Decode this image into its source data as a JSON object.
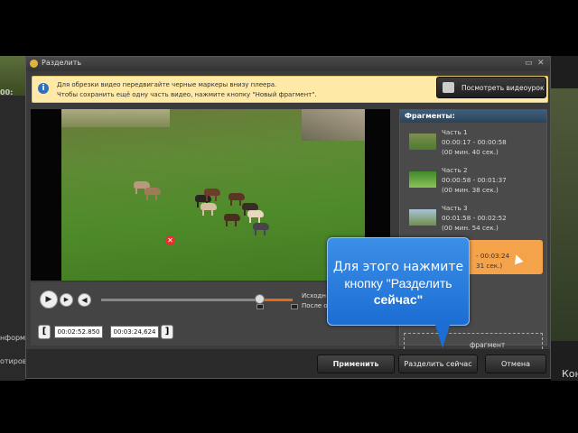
{
  "background": {
    "left_texts": [
      "00:",
      "нформац",
      "отирова"
    ],
    "right_text": "Кон"
  },
  "dialog": {
    "title": "Разделить",
    "info": {
      "line1": "Для обрезки видео передвигайте черные маркеры внизу плеера.",
      "line2": "Чтобы сохранить ещё одну часть видео, нажмите кнопку \"Новый фрагмент\".",
      "lesson_button": "Посмотреть видеоурок"
    },
    "player": {
      "side_label1": "Исходн",
      "side_label2": "После об",
      "start_time": "00:02:52.850",
      "end_time": "00:03:24,624",
      "progress": 0.82
    },
    "fragments": {
      "header": "Фрагменты:",
      "items": [
        {
          "name": "Часть 1",
          "range": "00:00:17 - 00:00:58",
          "duration": "(00 мин. 40 сек.)"
        },
        {
          "name": "Часть 2",
          "range": "00:00:58 - 00:01:37",
          "duration": "(00 мин. 38 сек.)"
        },
        {
          "name": "Часть 3",
          "range": "00:01:58 - 00:02:52",
          "duration": "(00 мин. 54 сек.)"
        },
        {
          "name": "",
          "range": "- 00:03:24",
          "duration": "31 сек.)"
        }
      ],
      "new_fragment": "фрагмент"
    },
    "buttons": {
      "apply": "Применить",
      "split_now": "Разделить сейчас",
      "cancel": "Отмена"
    },
    "tooltip": {
      "line1": "Для этого нажмите",
      "line2": "кнопку \"Разделить",
      "line3": "сейчас\""
    }
  }
}
